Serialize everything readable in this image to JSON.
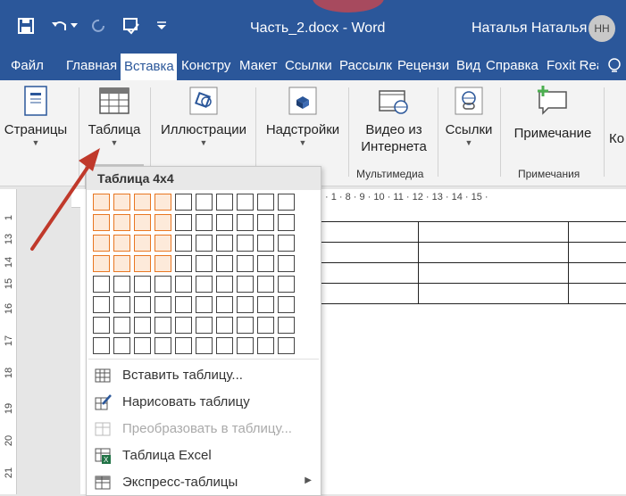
{
  "titlebar": {
    "doc_title": "Часть_2.docx  -  Word",
    "user_name": "Наталья Наталья",
    "avatar_initials": "НН"
  },
  "tabs": [
    "Файл",
    "Главная",
    "Вставка",
    "Констру",
    "Макет",
    "Ссылки",
    "Рассылк",
    "Рецензи",
    "Вид",
    "Справка",
    "Foxit Rea"
  ],
  "ribbon": {
    "pages": "Страницы",
    "table": "Таблица",
    "illustrations": "Иллюстрации",
    "addins": "Надстройки",
    "video_line1": "Видео из",
    "video_line2": "Интернета",
    "links": "Ссылки",
    "comment": "Примечание",
    "partial": "Ко",
    "group_media": "Мультимедиа",
    "group_comments": "Примечания"
  },
  "ruler": {
    "top": "· 1 · 8 · 9 · 10 · 11 · 12 · 13 · 14 · 15 ·",
    "left": [
      "1",
      "13",
      "14",
      "15",
      "16",
      "17",
      "18",
      "19",
      "20",
      "21"
    ]
  },
  "dropdown": {
    "header": "Таблица 4x4",
    "grid_rows": 8,
    "grid_cols": 10,
    "selected_rows": 4,
    "selected_cols": 4,
    "items": [
      {
        "label": "Вставить таблицу...",
        "disabled": false,
        "submenu": false
      },
      {
        "label": "Нарисовать таблицу",
        "disabled": false,
        "submenu": false
      },
      {
        "label": "Преобразовать в таблицу...",
        "disabled": true,
        "submenu": false
      },
      {
        "label": "Таблица Excel",
        "disabled": false,
        "submenu": false
      },
      {
        "label": "Экспресс-таблицы",
        "disabled": false,
        "submenu": true
      }
    ]
  },
  "colors": {
    "accent": "#2b579a",
    "selection": "#e87722",
    "arrow": "#c0392b"
  }
}
